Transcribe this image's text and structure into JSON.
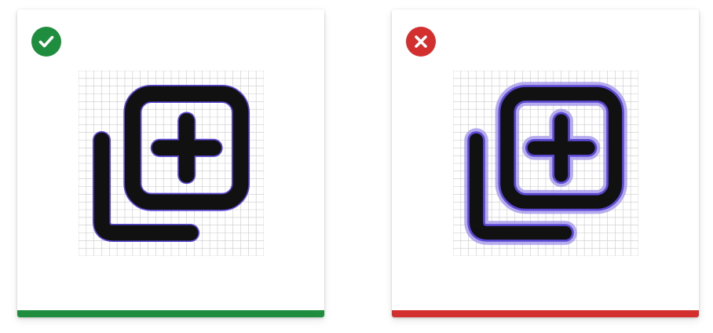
{
  "panels": [
    {
      "verdict": "correct",
      "badge_icon": "checkmark-icon",
      "figure_icon": "library-add-icon",
      "accent_color": "#1e8e3e"
    },
    {
      "verdict": "incorrect",
      "badge_icon": "close-icon",
      "figure_icon": "library-add-icon",
      "accent_color": "#d32f2f"
    }
  ]
}
